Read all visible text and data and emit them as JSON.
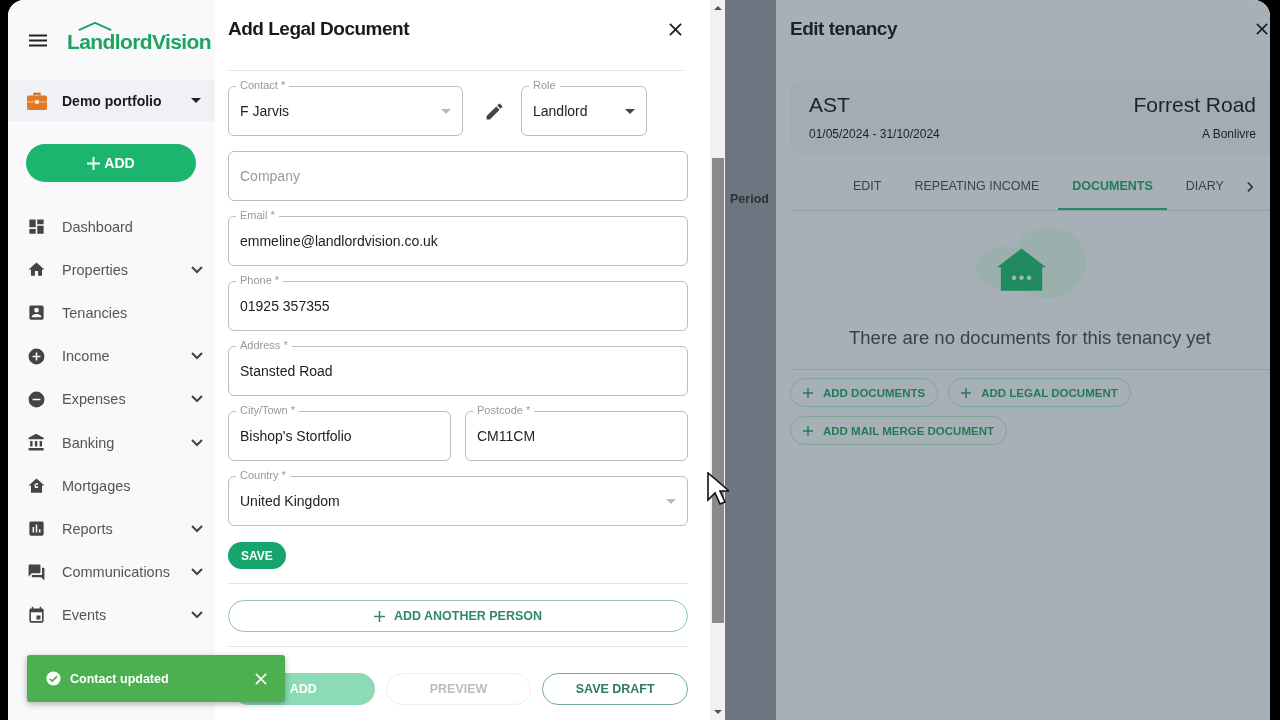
{
  "sidebar": {
    "logo": "LandlordVision",
    "portfolio": "Demo portfolio",
    "add_button": "ADD",
    "items": [
      {
        "label": "Dashboard",
        "expandable": false
      },
      {
        "label": "Properties",
        "expandable": true
      },
      {
        "label": "Tenancies",
        "expandable": false
      },
      {
        "label": "Income",
        "expandable": true
      },
      {
        "label": "Expenses",
        "expandable": true
      },
      {
        "label": "Banking",
        "expandable": true
      },
      {
        "label": "Mortgages",
        "expandable": false
      },
      {
        "label": "Reports",
        "expandable": true
      },
      {
        "label": "Communications",
        "expandable": true
      },
      {
        "label": "Events",
        "expandable": true
      }
    ]
  },
  "dialog": {
    "title": "Add Legal Document",
    "rows": [
      [
        {
          "kind": "select",
          "label": "Contact *",
          "value": "F Jarvis"
        },
        {
          "kind": "edit"
        },
        {
          "kind": "select",
          "label": "Role",
          "value": "Landlord"
        }
      ],
      [
        {
          "kind": "text",
          "placeholder": "Company"
        }
      ],
      [
        {
          "kind": "text",
          "label": "Email *",
          "value": "emmeline@landlordvision.co.uk"
        }
      ],
      [
        {
          "kind": "text",
          "label": "Phone *",
          "value": "01925 357355"
        }
      ],
      [
        {
          "kind": "text",
          "label": "Address *",
          "value": "Stansted Road"
        }
      ],
      [
        {
          "kind": "text",
          "label": "City/Town *",
          "value": "Bishop's Stortfolio"
        },
        {
          "kind": "text",
          "label": "Postcode *",
          "value": "CM11CM"
        }
      ],
      [
        {
          "kind": "select",
          "label": "Country *",
          "value": "United Kingdom"
        }
      ]
    ],
    "save_button": "SAVE",
    "add_person_button": "ADD ANOTHER PERSON",
    "footer_buttons": [
      {
        "label": "ADD",
        "kind": "primary",
        "disabled": true
      },
      {
        "label": "PREVIEW",
        "kind": "outlined",
        "disabled": true
      },
      {
        "label": "SAVE DRAFT",
        "kind": "outlined",
        "disabled": false
      }
    ]
  },
  "background_column": "Period",
  "tenancy": {
    "title": "Edit tenancy",
    "type": "AST",
    "dates": "01/05/2024 - 31/10/2024",
    "property": "Forrest Road",
    "tenant": "A Bonlivre",
    "tabs": [
      {
        "label": "EDIT",
        "selected": false
      },
      {
        "label": "REPEATING INCOME",
        "selected": false
      },
      {
        "label": "DOCUMENTS",
        "selected": true
      },
      {
        "label": "DIARY",
        "selected": false
      }
    ],
    "empty_message": "There are no documents for this tenancy yet",
    "buttons": [
      "ADD DOCUMENTS",
      "ADD LEGAL DOCUMENT",
      "ADD MAIL MERGE DOCUMENT"
    ]
  },
  "toast": {
    "message": "Contact updated"
  }
}
